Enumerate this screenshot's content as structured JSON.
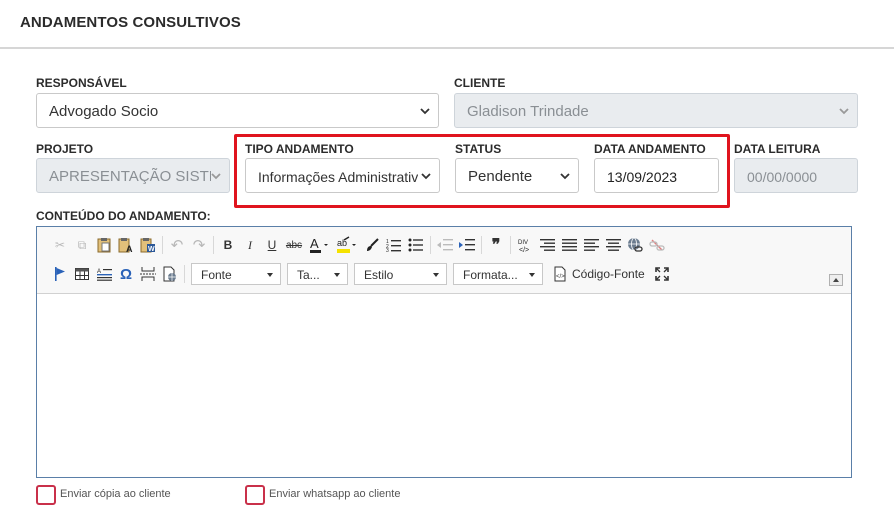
{
  "page": {
    "title": "ANDAMENTOS CONSULTIVOS"
  },
  "form": {
    "responsavel": {
      "label": "RESPONSÁVEL",
      "value": "Advogado Socio"
    },
    "cliente": {
      "label": "CLIENTE",
      "value": "Gladison Trindade"
    },
    "projeto": {
      "label": "PROJETO",
      "value": "APRESENTAÇÃO SISTE"
    },
    "tipo_andamento": {
      "label": "TIPO ANDAMENTO",
      "value": "Informações Administrativ"
    },
    "status": {
      "label": "STATUS",
      "value": "Pendente"
    },
    "data_andamento": {
      "label": "DATA ANDAMENTO",
      "value": "13/09/2023"
    },
    "data_leitura": {
      "label": "DATA LEITURA",
      "value": "00/00/0000"
    },
    "conteudo": {
      "label": "CONTEÚDO DO ANDAMENTO:"
    }
  },
  "editor": {
    "font_combo": "Fonte",
    "size_combo": "Ta...",
    "style_combo": "Estilo",
    "format_combo": "Formata...",
    "source_label": "Código-Fonte",
    "bold": "B",
    "italic": "I",
    "underline": "U",
    "strike": "abc",
    "omega": "Ω",
    "quote": "❞"
  },
  "checkboxes": {
    "copia": "Enviar cópia ao cliente",
    "whatsapp": "Enviar whatsapp ao cliente"
  },
  "colors": {
    "highlight": "#e0141e",
    "checkbox_border": "#c9304a",
    "editor_border": "#5a7fa8"
  }
}
